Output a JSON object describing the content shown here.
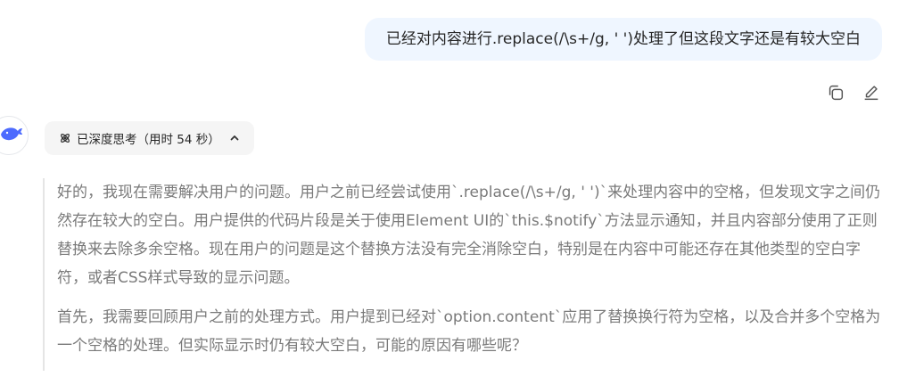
{
  "user_message": {
    "text": "已经对内容进行.replace(/\\s+/g, ' ')处理了但这段文字还是有较大空白"
  },
  "message_actions": {
    "copy_icon": "copy-icon",
    "edit_icon": "edit-icon"
  },
  "assistant": {
    "avatar_icon": "whale-logo-icon",
    "thinking_label": "已深度思考（用时 54 秒）",
    "reasoning_paragraphs": [
      "好的，我现在需要解决用户的问题。用户之前已经尝试使用`.replace(/\\s+/g, ' ')`来处理内容中的空格，但发现文字之间仍然存在较大的空白。用户提供的代码片段是关于使用Element UI的`this.$notify`方法显示通知，并且内容部分使用了正则替换来去除多余空格。现在用户的问题是这个替换方法没有完全消除空白，特别是在内容中可能还存在其他类型的空白字符，或者CSS样式导致的显示问题。",
      "首先，我需要回顾用户之前的处理方式。用户提到已经对`option.content`应用了替换换行符为空格，以及合并多个空格为一个空格的处理。但实际显示时仍有较大空白，可能的原因有哪些呢？"
    ]
  },
  "colors": {
    "user_bubble_bg": "#eff6ff",
    "chip_bg": "#f5f5f5",
    "reasoning_text": "#7a7a7a",
    "brand_blue": "#4d6bfe"
  }
}
